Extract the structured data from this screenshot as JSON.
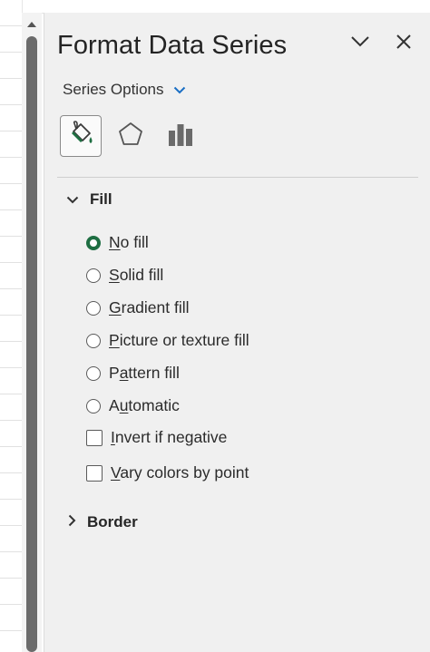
{
  "pane": {
    "title": "Format Data Series",
    "collapse_icon": "chevron-down-icon",
    "close_icon": "close-icon",
    "series_options_label": "Series Options"
  },
  "tabs": [
    {
      "name": "fill-line-tab",
      "icon": "paint-bucket-icon",
      "active": true
    },
    {
      "name": "effects-tab",
      "icon": "pentagon-icon",
      "active": false
    },
    {
      "name": "series-options-tab",
      "icon": "bar-chart-icon",
      "active": false
    }
  ],
  "fill": {
    "header": "Fill",
    "expanded": true,
    "options": [
      {
        "label": "No fill",
        "access_key": "N",
        "rest": "o fill",
        "checked": true
      },
      {
        "label": "Solid fill",
        "access_key": "S",
        "rest": "olid fill",
        "checked": false
      },
      {
        "label": "Gradient fill",
        "access_key": "G",
        "rest": "radient fill",
        "checked": false
      },
      {
        "label": "Picture or texture fill",
        "access_key": "P",
        "rest": "icture or texture fill",
        "checked": false
      },
      {
        "label": "Pattern fill",
        "pre": "P",
        "access_key": "a",
        "rest": "ttern fill",
        "checked": false
      },
      {
        "label": "Automatic",
        "pre": "A",
        "access_key": "u",
        "rest": "tomatic",
        "checked": false
      }
    ],
    "checkboxes": [
      {
        "label": "Invert if negative",
        "access_key": "I",
        "rest": "nvert if negative",
        "checked": false
      },
      {
        "label": "Vary colors by point",
        "access_key": "V",
        "rest": "ary colors by point",
        "checked": false
      }
    ]
  },
  "border": {
    "header": "Border",
    "expanded": false
  },
  "colors": {
    "pane_bg": "#f0f0f0",
    "accent_green": "#1e6e42",
    "scroll_thumb": "#6b6b6b"
  }
}
